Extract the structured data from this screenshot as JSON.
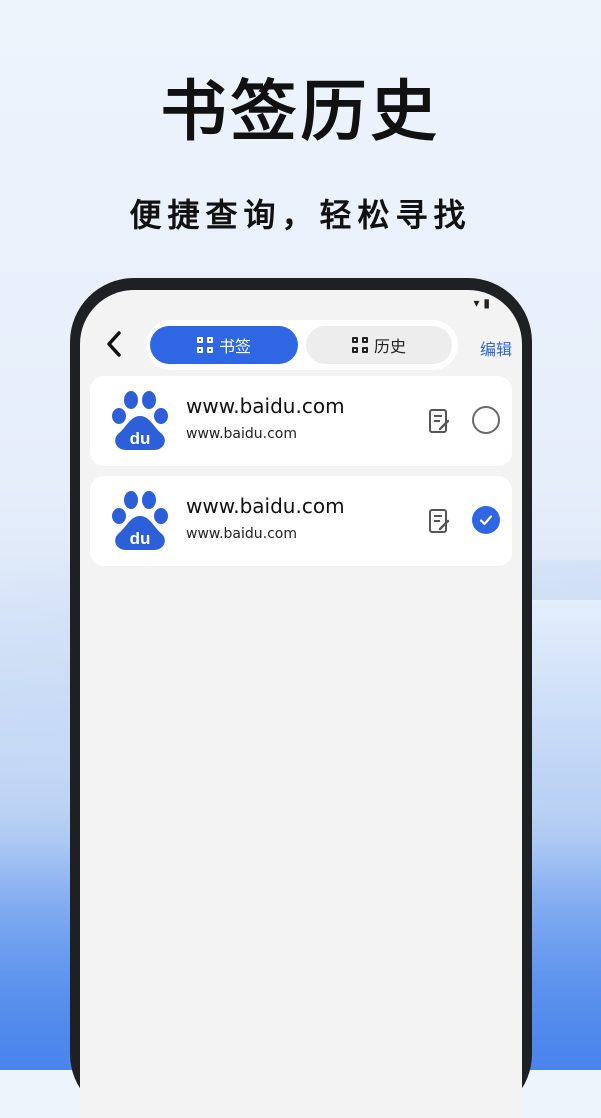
{
  "hero": {
    "title": "书签历史",
    "subtitle": "便捷查询，轻松寻找"
  },
  "nav": {
    "tabs": [
      {
        "label": "书签",
        "active": true
      },
      {
        "label": "历史",
        "active": false
      }
    ],
    "edit_label": "编辑"
  },
  "bookmarks": [
    {
      "title": "www.baidu.com",
      "url": "www.baidu.com",
      "logo": "baidu-paw-logo",
      "selected": false
    },
    {
      "title": "www.baidu.com",
      "url": "www.baidu.com",
      "logo": "baidu-paw-logo",
      "selected": true
    }
  ],
  "colors": {
    "accent": "#2f66e4",
    "baidu_blue": "#2d5fd9"
  }
}
